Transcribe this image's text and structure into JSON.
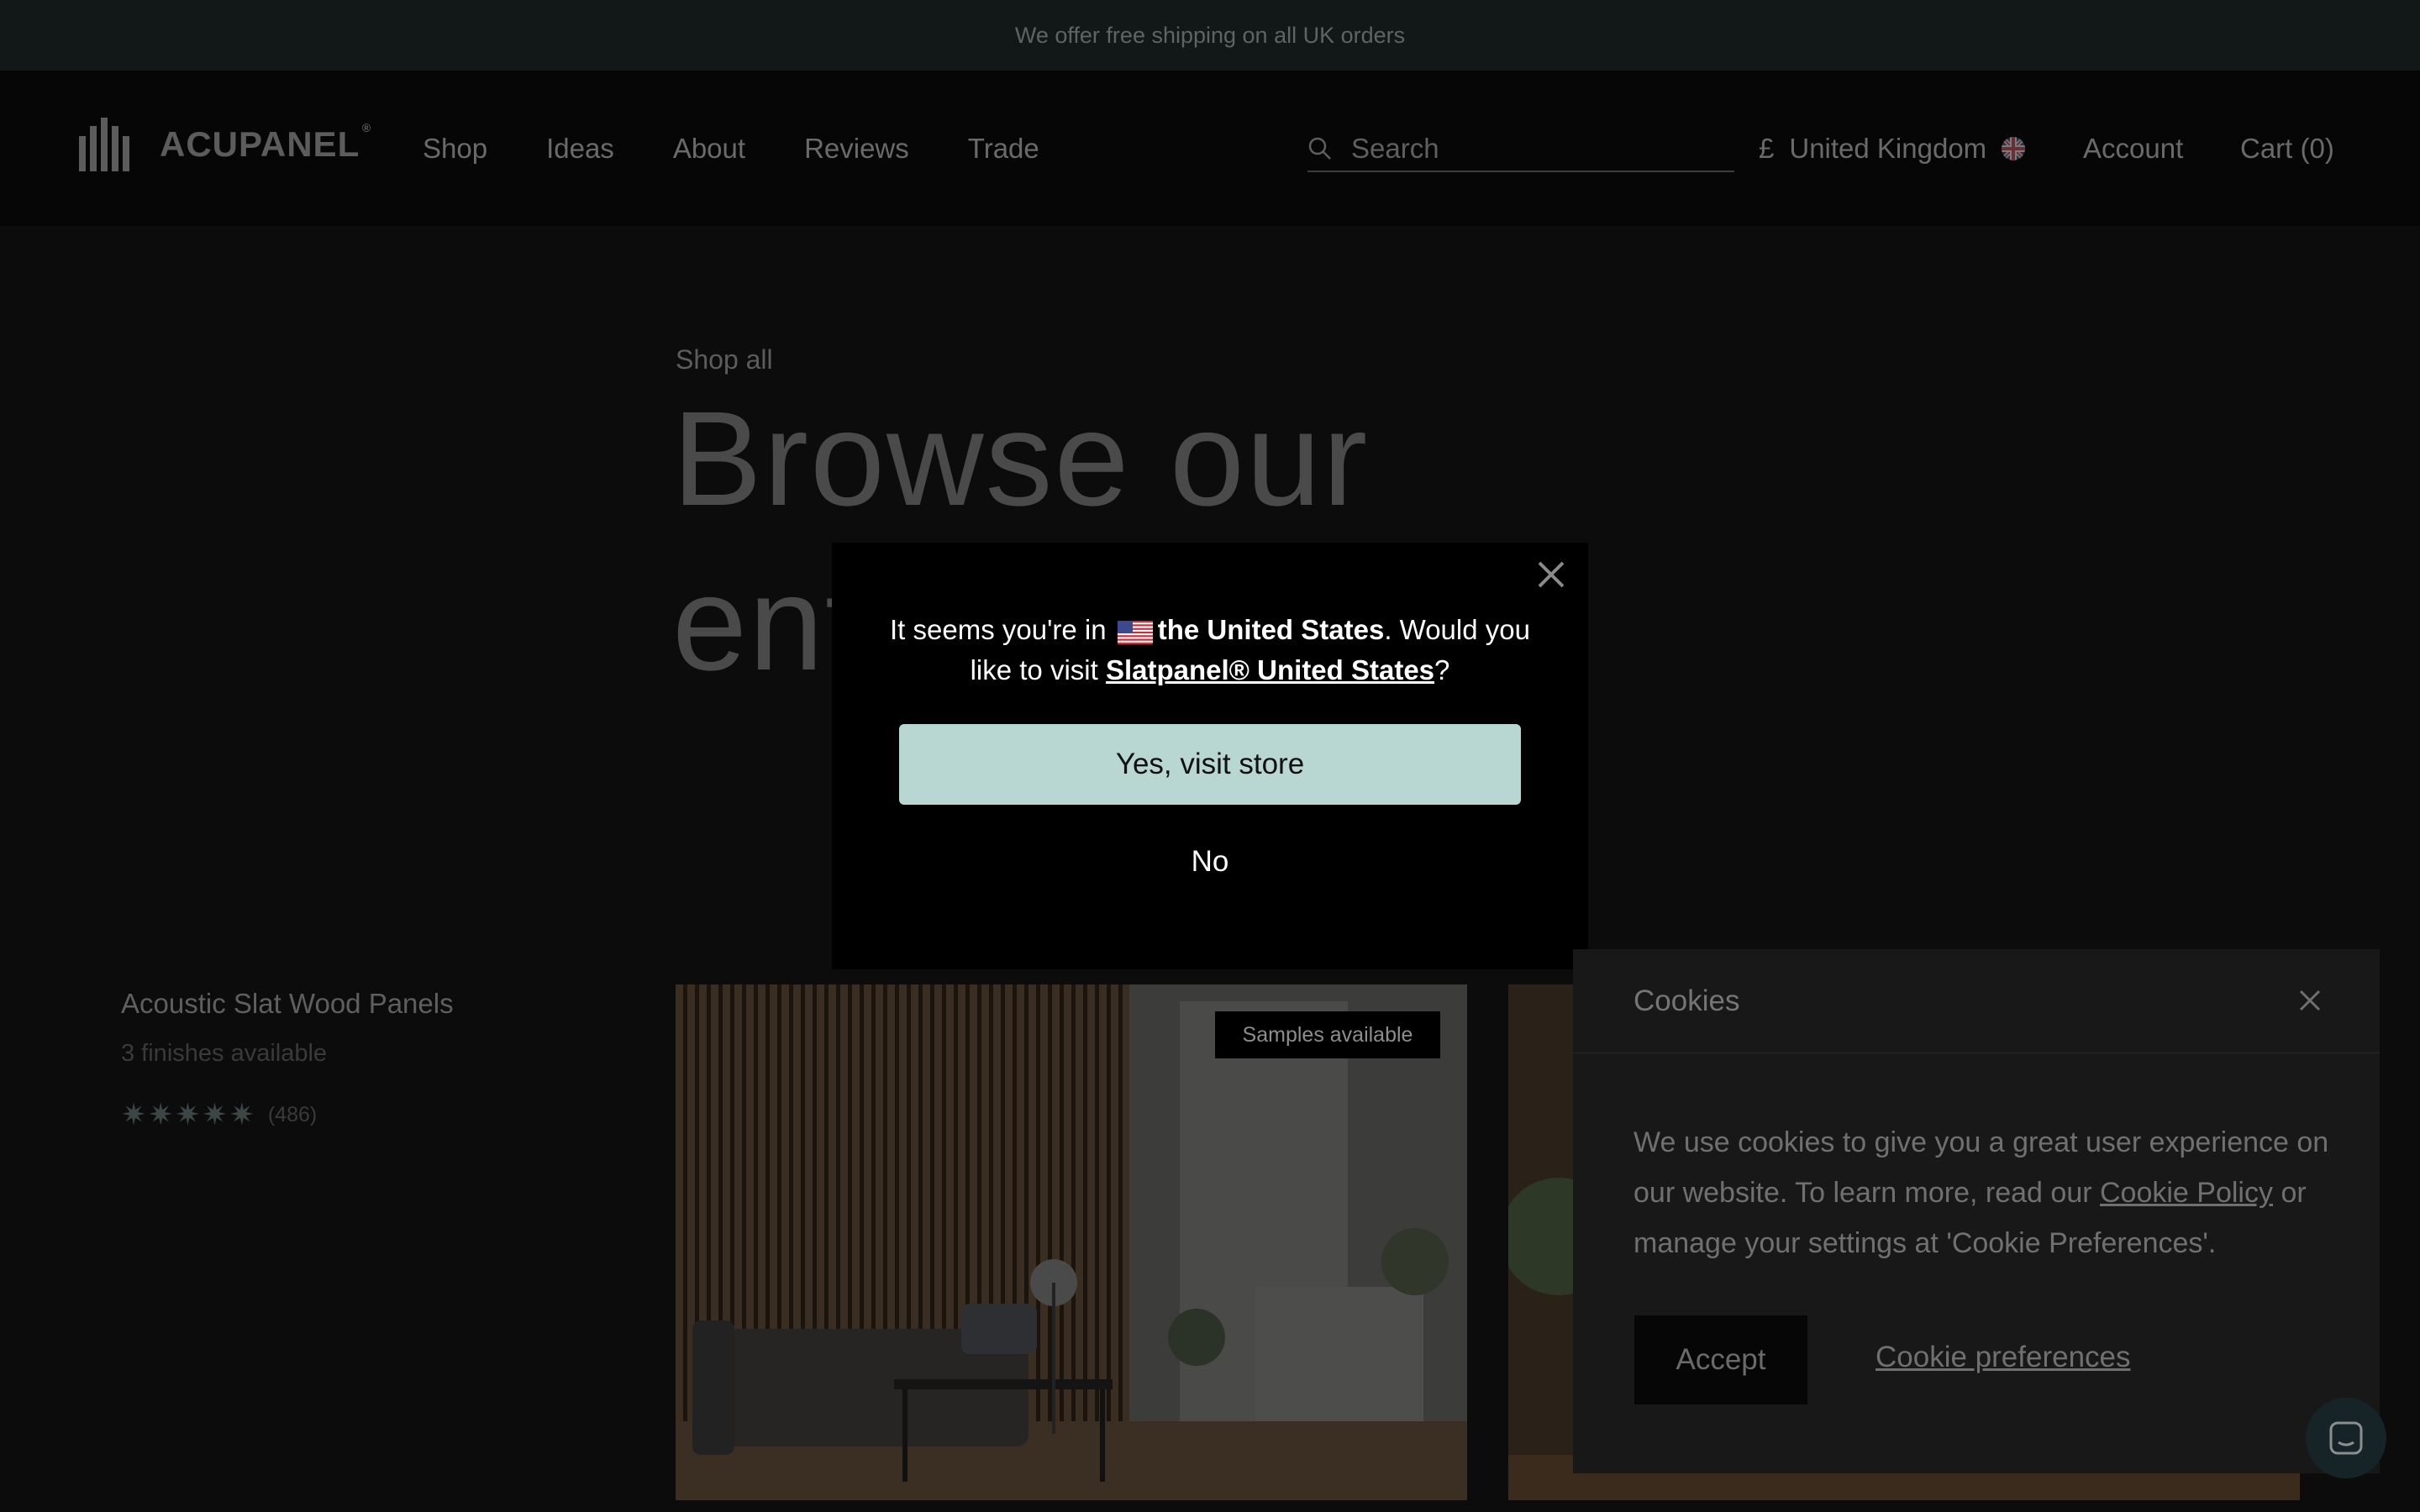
{
  "announcement": "We offer free shipping on all UK orders",
  "header": {
    "brand": "ACUPANEL",
    "nav": [
      "Shop",
      "Ideas",
      "About",
      "Reviews",
      "Trade"
    ],
    "search_placeholder": "Search",
    "currency": "£",
    "region": "United Kingdom",
    "account": "Account",
    "cart": "Cart (0)"
  },
  "hero": {
    "eyebrow": "Shop all",
    "title_line1": "Browse our",
    "title_line2": "ent"
  },
  "product": {
    "name": "Acoustic Slat Wood Panels",
    "finishes": "3 finishes available",
    "rating_stars": 5,
    "review_count": "(486)",
    "badge": "Samples available"
  },
  "geo_modal": {
    "text_prefix": "It seems you're in",
    "country": "the United States",
    "text_mid": ". Would you like to visit",
    "store_link": "Slatpanel® United States",
    "text_suffix": "?",
    "yes_label": "Yes, visit store",
    "no_label": "No"
  },
  "cookies": {
    "title": "Cookies",
    "body_prefix": "We use cookies to give you a great user experience on our website. To learn more, read our",
    "policy_link": "Cookie Policy",
    "body_suffix": "or manage your settings at 'Cookie Preferences'.",
    "accept_label": "Accept",
    "prefs_label": "Cookie preferences"
  },
  "colors": {
    "accent_button": "#b8d6d2",
    "announcement_bg": "#121717",
    "modal_bg": "#000000"
  }
}
